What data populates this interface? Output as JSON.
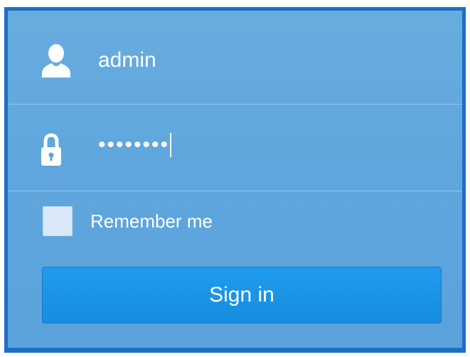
{
  "login": {
    "username": {
      "icon": "user-icon",
      "value": "admin"
    },
    "password": {
      "icon": "lock-icon",
      "masked_value": "••••••••"
    },
    "remember": {
      "label": "Remember me",
      "checked": false
    },
    "submit_label": "Sign in"
  },
  "colors": {
    "panel_background": "#5ea6dd",
    "panel_border": "#1c6fc6",
    "button_background": "#1a93e6",
    "text": "#ffffff"
  }
}
